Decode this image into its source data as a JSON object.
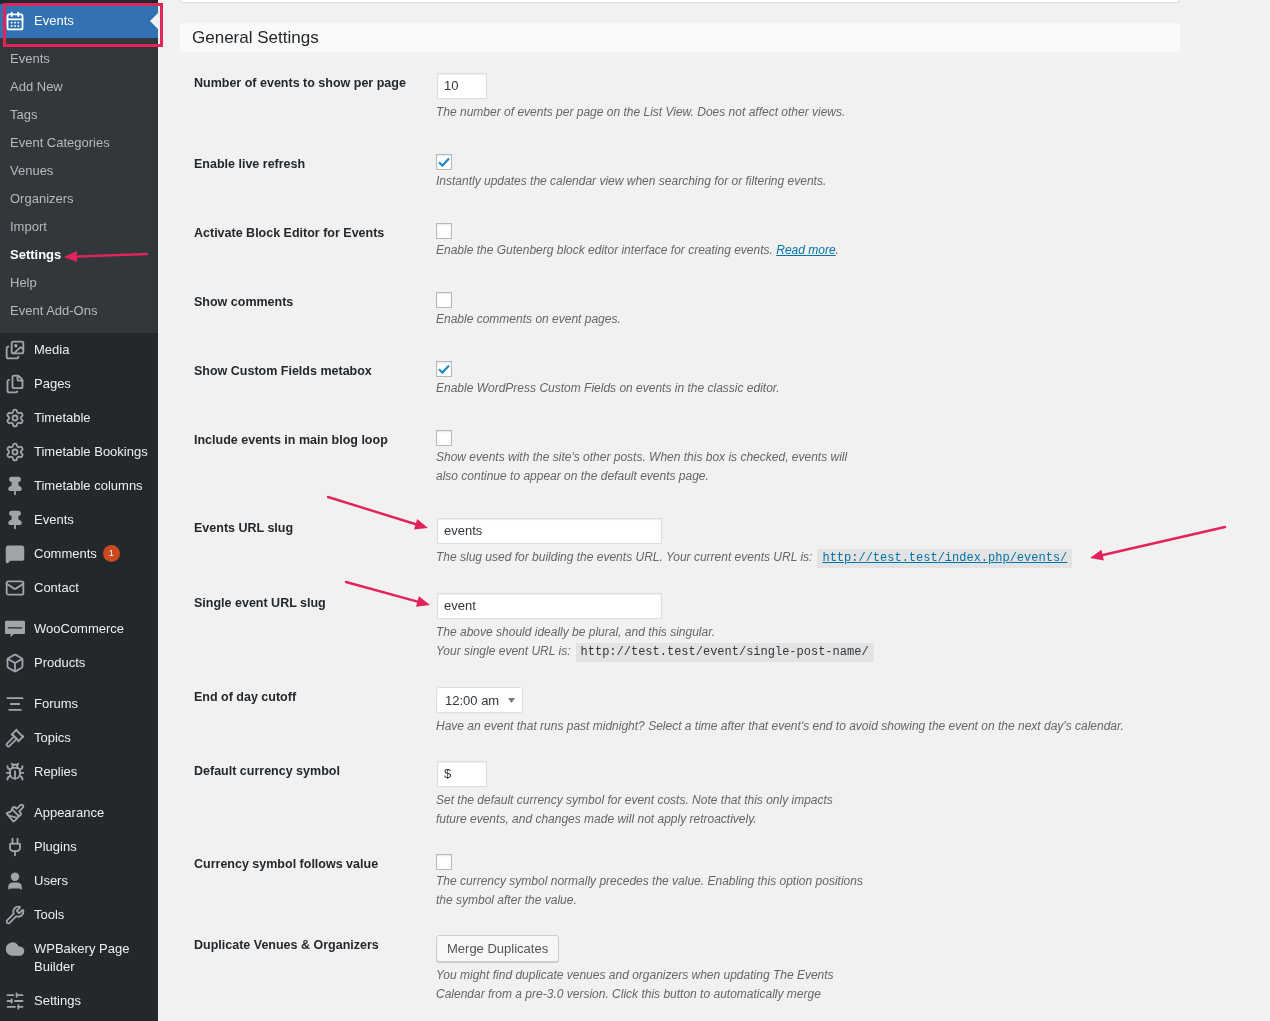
{
  "sidebar": {
    "groups": [
      {
        "items": [
          {
            "label": "Events",
            "selected": true,
            "submenu": [
              {
                "label": "Events",
                "selected": false
              },
              {
                "label": "Add New",
                "selected": false
              },
              {
                "label": "Tags",
                "selected": false
              },
              {
                "label": "Event Categories",
                "selected": false
              },
              {
                "label": "Venues",
                "selected": false
              },
              {
                "label": "Organizers",
                "selected": false
              },
              {
                "label": "Import",
                "selected": false
              },
              {
                "label": "Settings",
                "selected": true
              },
              {
                "label": "Help",
                "selected": false
              },
              {
                "label": "Event Add-Ons",
                "selected": false
              }
            ]
          },
          {
            "label": "Media",
            "selected": false
          },
          {
            "label": "Pages",
            "selected": false
          },
          {
            "label": "Timetable",
            "selected": false
          },
          {
            "label": "Timetable Bookings",
            "selected": false
          },
          {
            "label": "Timetable columns",
            "selected": false
          },
          {
            "label": "Events",
            "selected": false
          },
          {
            "label": "Comments",
            "selected": false,
            "badge": "1"
          },
          {
            "label": "Contact",
            "selected": false
          }
        ]
      },
      {
        "items": [
          {
            "label": "WooCommerce",
            "selected": false
          },
          {
            "label": "Products",
            "selected": false
          }
        ]
      },
      {
        "items": [
          {
            "label": "Forums",
            "selected": false
          },
          {
            "label": "Topics",
            "selected": false
          },
          {
            "label": "Replies",
            "selected": false
          }
        ]
      },
      {
        "items": [
          {
            "label": "Appearance",
            "selected": false
          },
          {
            "label": "Plugins",
            "selected": false
          },
          {
            "label": "Users",
            "selected": false
          },
          {
            "label": "Tools",
            "selected": false
          },
          {
            "label": "WPBakery Page Builder",
            "selected": false
          },
          {
            "label": "Settings",
            "selected": false
          }
        ]
      }
    ]
  },
  "settings": {
    "title": "General Settings",
    "rows": [
      {
        "label": "Number of events to show per page",
        "field": {
          "kind": "short_text",
          "value": "10"
        },
        "description": "The number of events per page on the List View. Does not affect other views."
      },
      {
        "label": "Enable live refresh",
        "field": {
          "kind": "checkbox",
          "checked": true
        },
        "description": "Instantly updates the calendar view when searching for or filtering events."
      },
      {
        "label": "Activate Block Editor for Events",
        "field": {
          "kind": "checkbox",
          "checked": false
        },
        "description": "Enable the Gutenberg block editor interface for creating events.",
        "link": "Read more",
        "link_suffix": "."
      },
      {
        "label": "Show comments",
        "field": {
          "kind": "checkbox",
          "checked": false
        },
        "description": "Enable comments on event pages."
      },
      {
        "label": "Show Custom Fields metabox",
        "field": {
          "kind": "checkbox",
          "checked": true
        },
        "description": "Enable WordPress Custom Fields on events in the classic editor."
      },
      {
        "label": "Include events in main blog loop",
        "field": {
          "kind": "checkbox",
          "checked": false
        },
        "description": "Show events with the site's other posts. When this box is checked, events will\nalso continue to appear on the default events page."
      },
      {
        "label": "Events URL slug",
        "field": {
          "kind": "text",
          "value": "events"
        },
        "description": "The slug used for building the events URL. Your current events URL is:",
        "url": {
          "kind": "link",
          "text": "http://test.test/index.php/events/"
        }
      },
      {
        "label": "Single event URL slug",
        "field": {
          "kind": "text",
          "value": "event"
        },
        "description": "The above should ideally be plural, and this singular.",
        "url_note": "Your single event URL is:",
        "url": {
          "kind": "code",
          "text": "http://test.test/event/single-post-name/"
        }
      },
      {
        "label": "End of day cutoff",
        "field": {
          "kind": "select",
          "value": "12:00 am"
        },
        "description": "Have an event that runs past midnight? Select a time after that event's end to avoid showing the event on the next day's calendar."
      },
      {
        "label": "Default currency symbol",
        "field": {
          "kind": "short_text",
          "value": "$"
        },
        "description": "Set the default currency symbol for event costs. Note that this only impacts\nfuture events, and changes made will not apply retroactively."
      },
      {
        "label": "Currency symbol follows value",
        "field": {
          "kind": "checkbox",
          "checked": false
        },
        "description": "The currency symbol normally precedes the value. Enabling this option positions\nthe symbol after the value."
      },
      {
        "label": "Duplicate Venues & Organizers",
        "field": {
          "kind": "button",
          "label": "Merge Duplicates"
        },
        "description": "You might find duplicate venues and organizers when updating The Events\nCalendar from a pre-3.0 version. Click this button to automatically merge"
      }
    ]
  }
}
